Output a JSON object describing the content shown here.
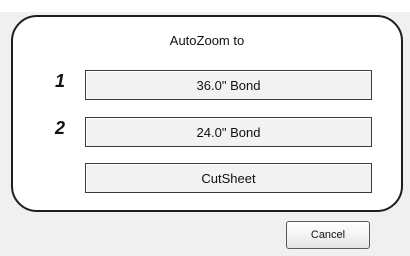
{
  "dialog": {
    "title": "AutoZoom to",
    "options": [
      {
        "number": "1",
        "label": "36.0\" Bond"
      },
      {
        "number": "2",
        "label": "24.0\" Bond"
      },
      {
        "number": "",
        "label": "CutSheet"
      }
    ],
    "cancel_label": "Cancel"
  }
}
